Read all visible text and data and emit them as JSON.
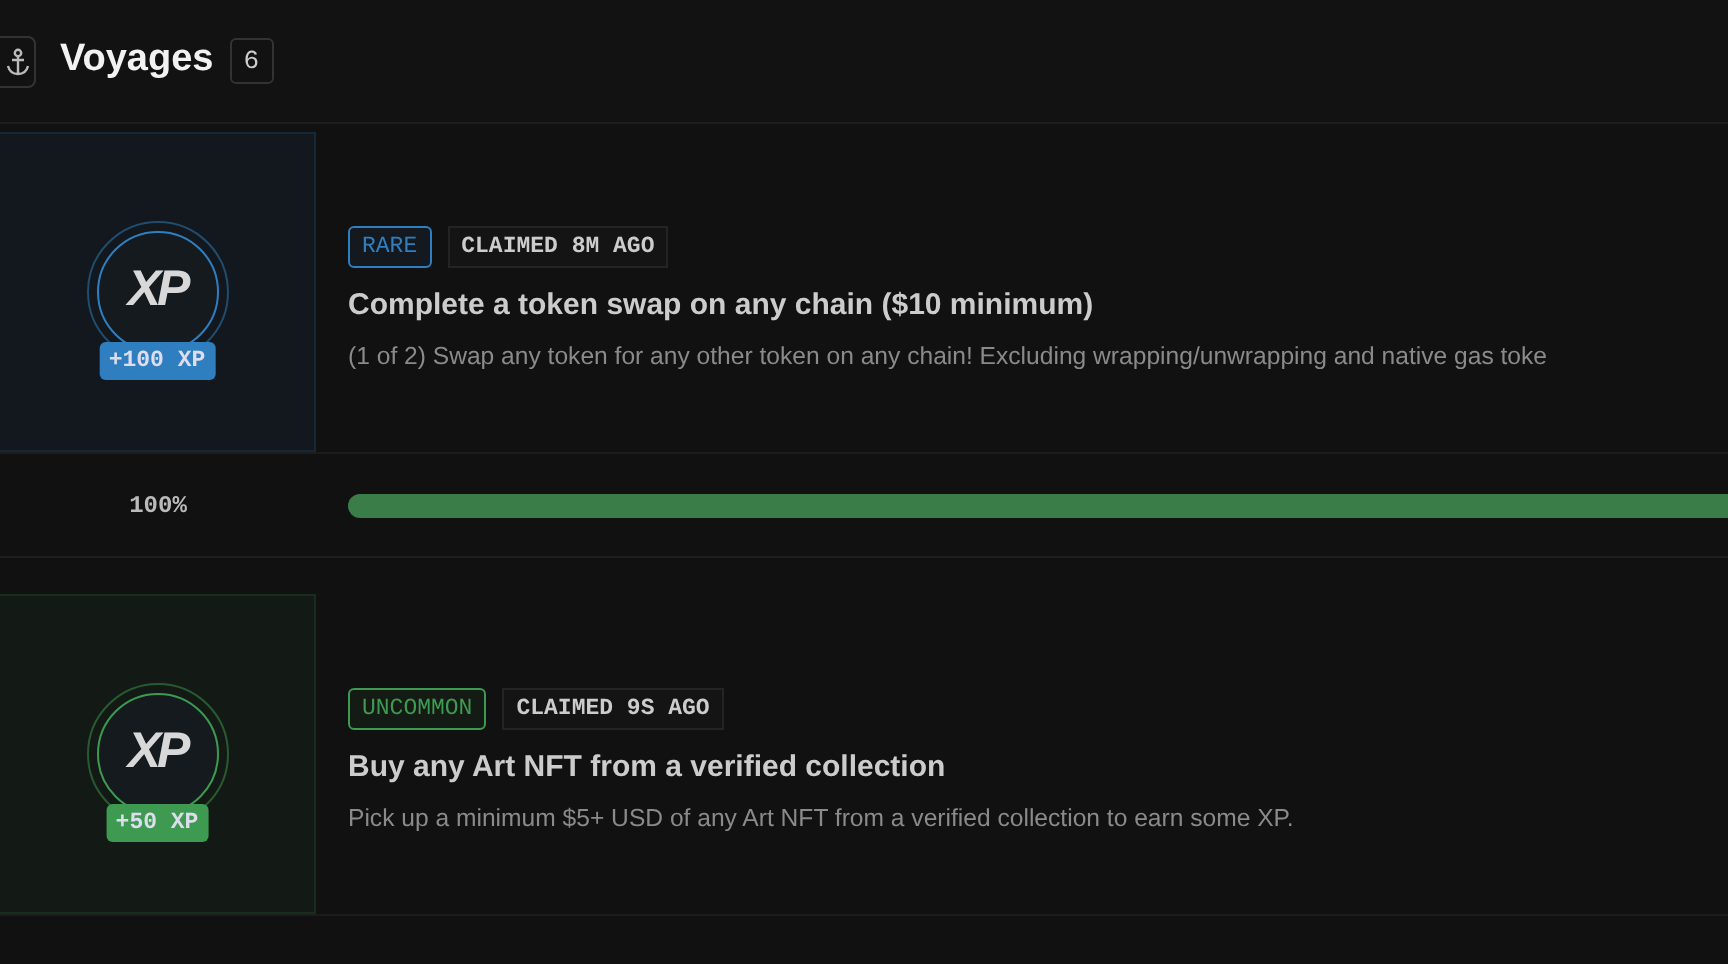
{
  "header": {
    "title": "Voyages",
    "count": "6"
  },
  "voyages": [
    {
      "rarity": "RARE",
      "color": "#2f7fc0",
      "claimed": "CLAIMED 8M AGO",
      "coin_text": "XP",
      "xp": "+100 XP",
      "title": "Complete a token swap on any chain ($10 minimum)",
      "description": "(1 of 2) Swap any token for any other token on any chain! Excluding wrapping/unwrapping and native gas toke",
      "progress": {
        "reading": "100%",
        "level": 1
      }
    },
    {
      "rarity": "UNCOMMON",
      "color": "#3d9a50",
      "claimed": "CLAIMED 9S AGO",
      "coin_text": "XP",
      "xp": "+50 XP",
      "title": "Buy any Art NFT from a verified collection",
      "description": "Pick up a minimum $5+ USD of any Art NFT from a verified collection to earn some XP."
    }
  ]
}
